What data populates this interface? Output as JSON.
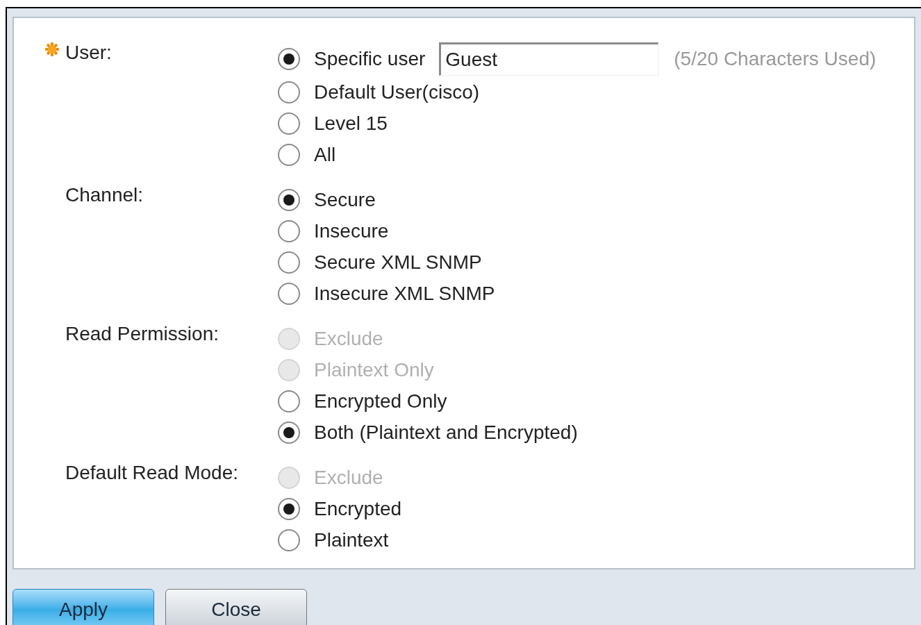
{
  "fields": [
    {
      "label": "User:",
      "required": true,
      "options": [
        {
          "label": "Specific user",
          "selected": true,
          "disabled": false,
          "input": {
            "value": "Guest",
            "note": "(5/20 Characters Used)"
          }
        },
        {
          "label": "Default User(cisco)",
          "selected": false,
          "disabled": false
        },
        {
          "label": "Level 15",
          "selected": false,
          "disabled": false
        },
        {
          "label": "All",
          "selected": false,
          "disabled": false
        }
      ]
    },
    {
      "label": "Channel:",
      "required": false,
      "options": [
        {
          "label": "Secure",
          "selected": true,
          "disabled": false
        },
        {
          "label": "Insecure",
          "selected": false,
          "disabled": false
        },
        {
          "label": "Secure XML SNMP",
          "selected": false,
          "disabled": false
        },
        {
          "label": "Insecure XML SNMP",
          "selected": false,
          "disabled": false
        }
      ]
    },
    {
      "label": "Read Permission:",
      "required": false,
      "options": [
        {
          "label": "Exclude",
          "selected": false,
          "disabled": true
        },
        {
          "label": "Plaintext Only",
          "selected": false,
          "disabled": true
        },
        {
          "label": "Encrypted Only",
          "selected": false,
          "disabled": false
        },
        {
          "label": "Both (Plaintext and Encrypted)",
          "selected": true,
          "disabled": false
        }
      ]
    },
    {
      "label": "Default Read Mode:",
      "required": false,
      "options": [
        {
          "label": "Exclude",
          "selected": false,
          "disabled": true
        },
        {
          "label": "Encrypted",
          "selected": true,
          "disabled": false
        },
        {
          "label": "Plaintext",
          "selected": false,
          "disabled": false
        }
      ]
    }
  ],
  "buttons": [
    {
      "label": "Apply",
      "kind": "primary"
    },
    {
      "label": "Close",
      "kind": "secondary"
    }
  ]
}
